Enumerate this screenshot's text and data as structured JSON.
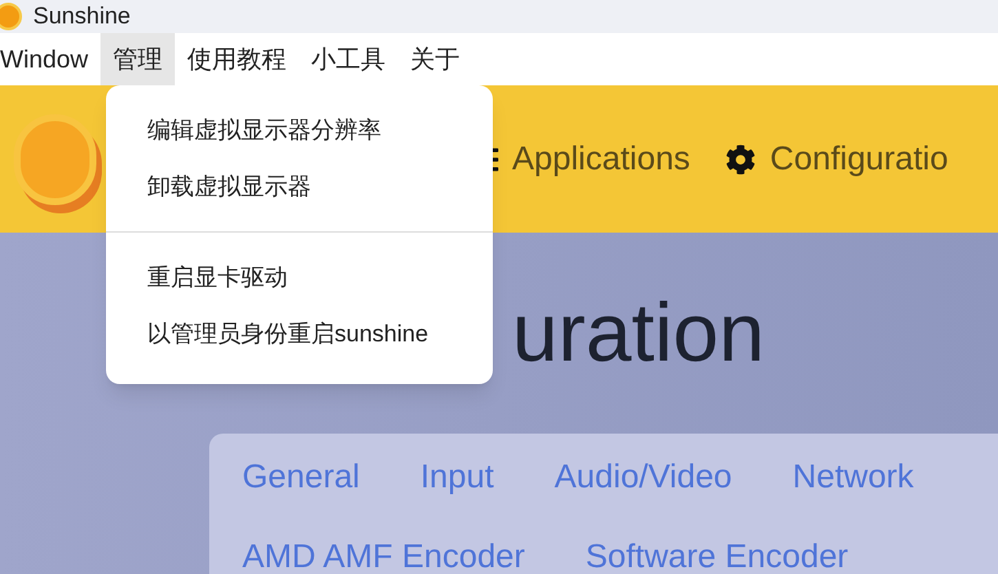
{
  "window": {
    "title": "Sunshine"
  },
  "menu_bar": [
    {
      "label": "Window",
      "selected": false
    },
    {
      "label": "管理",
      "selected": true
    },
    {
      "label": "使用教程",
      "selected": false
    },
    {
      "label": "小工具",
      "selected": false
    },
    {
      "label": "关于",
      "selected": false
    }
  ],
  "dropdown": {
    "groups": [
      [
        "编辑虚拟显示器分辨率",
        "卸载虚拟显示器"
      ],
      [
        "重启显卡驱动",
        "以管理员身份重启sunshine"
      ]
    ]
  },
  "nav": [
    {
      "label": "Applications",
      "kind": "list"
    },
    {
      "label": "Configuratio",
      "kind": "gear"
    }
  ],
  "heading": "uration",
  "config_tabs": [
    [
      "General",
      "Input",
      "Audio/Video",
      "Network"
    ],
    [
      "AMD AMF Encoder",
      "Software Encoder"
    ]
  ]
}
